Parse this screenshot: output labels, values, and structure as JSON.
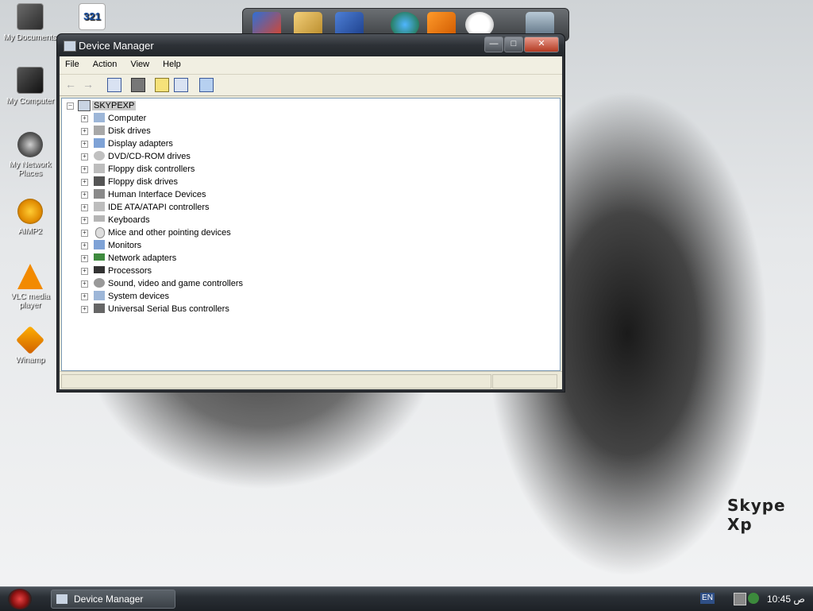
{
  "desktop": {
    "icons": [
      {
        "label": "My Documents",
        "icon": "documents-folder-icon"
      },
      {
        "label": "My Computer",
        "icon": "computer-icon"
      },
      {
        "label": "My Network Places",
        "icon": "network-places-icon"
      },
      {
        "label": "AIMP2",
        "icon": "aimp-icon"
      },
      {
        "label": "VLC media player",
        "icon": "vlc-icon"
      },
      {
        "label": "Winamp",
        "icon": "winamp-icon"
      },
      {
        "label": "321",
        "icon": "media-player-classic-icon"
      }
    ],
    "wallpaper_text": "Skype Xp"
  },
  "window": {
    "title": "Device Manager",
    "menu": [
      "File",
      "Action",
      "View",
      "Help"
    ],
    "toolbar": [
      "back-icon",
      "forward-icon",
      "properties-icon",
      "print-icon",
      "help-icon",
      "view-icon",
      "scan-hardware-icon"
    ],
    "tree": {
      "root": "SKYPEXP",
      "items": [
        "Computer",
        "Disk drives",
        "Display adapters",
        "DVD/CD-ROM drives",
        "Floppy disk controllers",
        "Floppy disk drives",
        "Human Interface Devices",
        "IDE ATA/ATAPI controllers",
        "Keyboards",
        "Mice and other pointing devices",
        "Monitors",
        "Network adapters",
        "Processors",
        "Sound, video and game controllers",
        "System devices",
        "Universal Serial Bus controllers"
      ]
    }
  },
  "taskbar": {
    "task_label": "Device Manager",
    "language": "EN",
    "clock": "10:45 ص"
  },
  "colors": {
    "tree_root_highlight": "#c9c9c9",
    "taskbar": "#2a2f35",
    "title_bar": "#2d3136",
    "close_button": "#b33a22"
  }
}
